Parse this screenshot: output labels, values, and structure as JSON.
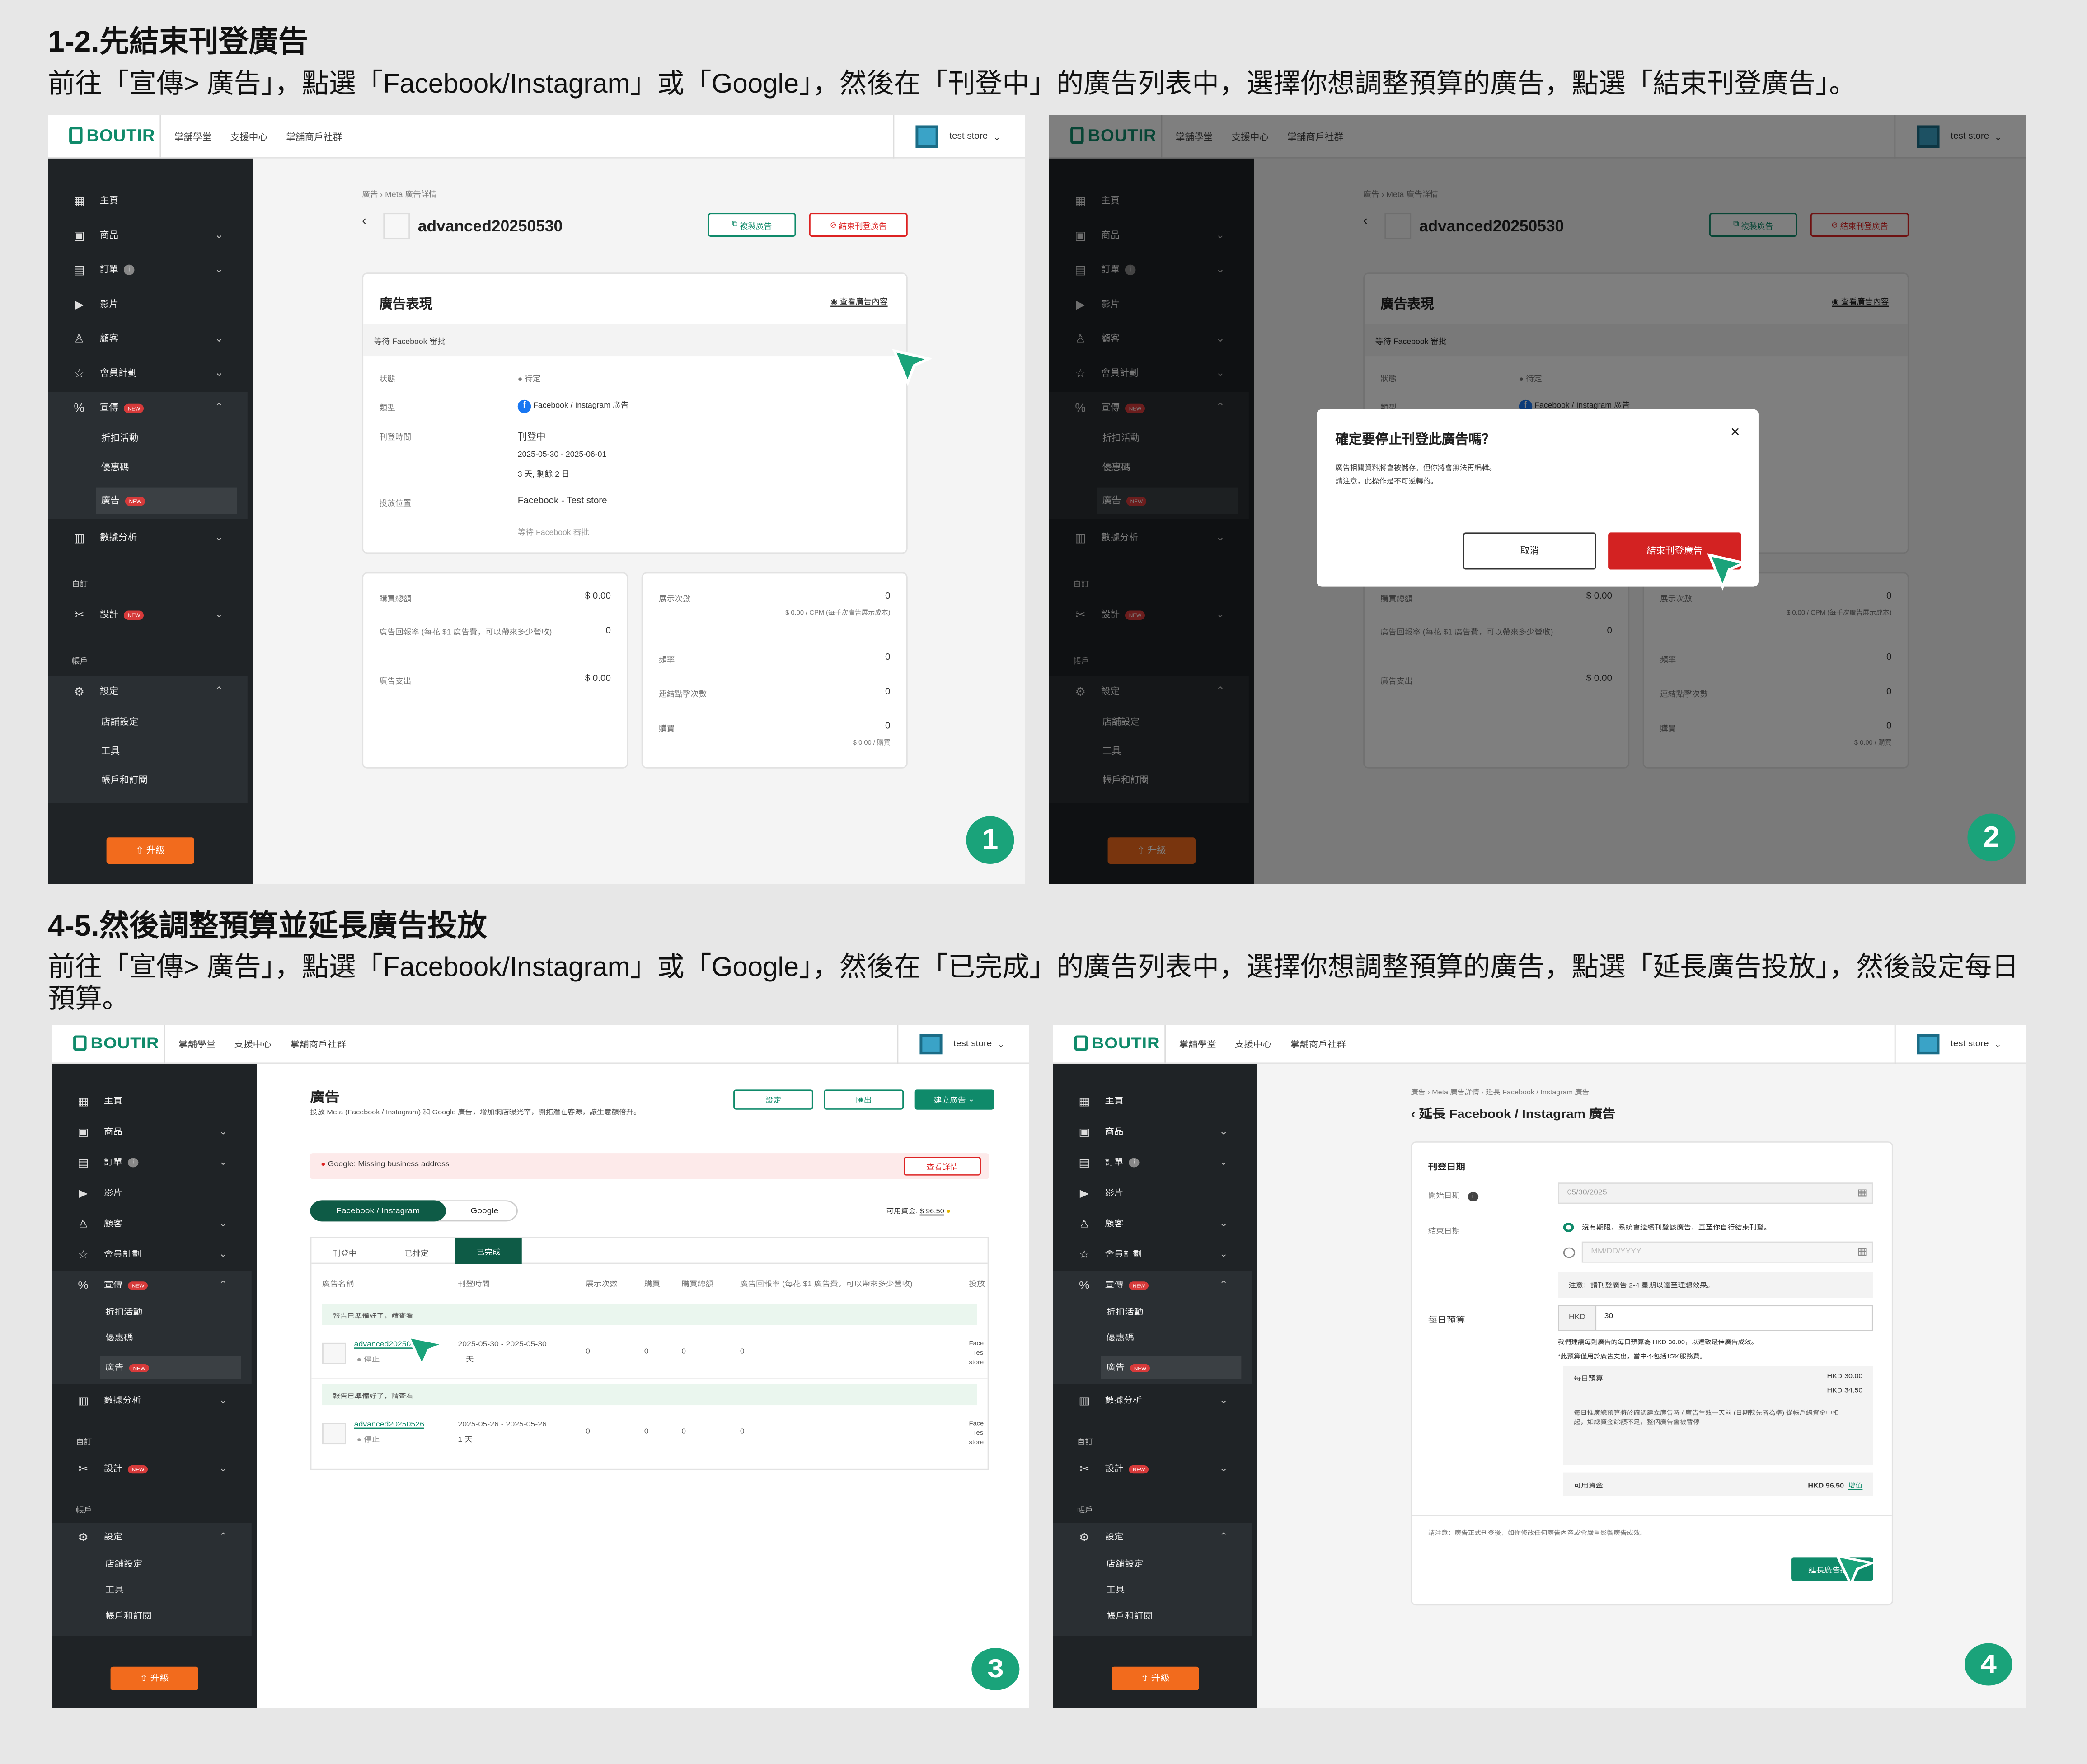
{
  "section1": {
    "heading": "1-2.先結束刊登廣告",
    "desc": "前往「宣傳> 廣告」，點選「Facebook/Instagram」或「Google」，然後在「刊登中」的廣告列表中，選擇你想調整預算的廣告，點選「結束刊登廣告」。"
  },
  "section2": {
    "heading": "4-5.然後調整預算並延長廣告投放",
    "desc": "前往「宣傳> 廣告」，點選「Facebook/Instagram」或「Google」，然後在「已完成」的廣告列表中，選擇你想調整預算的廣告，點選「延長廣告投放」，然後設定每日預算。"
  },
  "topbar": {
    "logo": "BOUTIR",
    "links": [
      "掌舖學堂",
      "支援中心",
      "掌舖商戶社群"
    ],
    "store": "test store"
  },
  "sidebar": {
    "home": "主頁",
    "products": "商品",
    "orders": "訂單",
    "videos": "影片",
    "customers": "顧客",
    "membership": "會員計劃",
    "promotion": "宣傳",
    "new_badge": "NEW",
    "discounts": "折扣活動",
    "coupons": "優惠碼",
    "ads": "廣告",
    "analytics": "數據分析",
    "custom_group": "自訂",
    "design": "設計",
    "account_group": "帳戶",
    "settings": "設定",
    "store_settings": "店舖設定",
    "tools": "工具",
    "billing": "帳戶和訂閱",
    "upgrade": "升級"
  },
  "step_numbers": [
    "1",
    "2",
    "3",
    "4"
  ],
  "detail": {
    "breadcrumb": "廣告 › Meta 廣告詳情",
    "ad_name": "advanced20250530",
    "copy_btn": "複製廣告",
    "stop_btn": "結束刊登廣告",
    "perf_title": "廣告表現",
    "view_content": "查看廣告內容",
    "waiting": "等待 Facebook 審批",
    "status_label": "狀態",
    "status_value": "待定",
    "type_label": "類型",
    "type_value": "Facebook / Instagram 廣告",
    "period_label": "刊登時間",
    "period_status": "刊登中",
    "period_range": "2025-05-30 - 2025-06-01",
    "period_left": "3 天, 剩餘 2 日",
    "placement_label": "投放位置",
    "placement_value": "Facebook - Test store",
    "placement_note": "等待 Facebook 審批",
    "purchase_total_label": "購買總額",
    "purchase_total": "$ 0.00",
    "roas_label": "廣告回報率 (每花 $1 廣告費，可以帶來多少營收)",
    "roas": "0",
    "spend_label": "廣告支出",
    "spend": "$ 0.00",
    "impressions_label": "展示次數",
    "impressions": "0",
    "cpm": "$ 0.00 / CPM (每千次廣告展示成本)",
    "freq_label": "頻率",
    "freq": "0",
    "clicks_label": "連結點擊次數",
    "clicks": "0",
    "purchases_label": "購買",
    "purchases": "0",
    "per_purchase": "$ 0.00 / 購買"
  },
  "modal": {
    "title": "確定要停止刊登此廣告嗎？",
    "line1": "廣告相關資料將會被儲存，但你將會無法再編輯。",
    "line2": "請注意，此操作是不可逆轉的。",
    "cancel": "取消",
    "confirm": "結束刊登廣告",
    "close": "×"
  },
  "ads_list": {
    "title": "廣告",
    "subtitle": "投放 Meta (Facebook / Instagram) 和 Google 廣告，增加網店曝光率，開拓潛在客源，讓生意額倍升。",
    "settings_btn": "設定",
    "export_btn": "匯出",
    "create_btn": "建立廣告",
    "alert": "Google: Missing business address",
    "alert_btn": "查看詳情",
    "toggle_fb": "Facebook / Instagram",
    "toggle_google": "Google",
    "funds_label": "可用資金:",
    "funds": "$ 96.50",
    "tabs": [
      "刊登中",
      "已排定",
      "已完成"
    ],
    "columns": [
      "廣告名稱",
      "刊登時間",
      "展示次數",
      "購買",
      "購買總額",
      "廣告回報率 (每花 $1 廣告費，可以帶來多少營收)",
      "投放"
    ],
    "ready_text": "報告已準備好了，請查看",
    "rows": [
      {
        "name": "advanced20250530",
        "status": "停止",
        "period": "2025-05-30 - 2025-05-30",
        "days": "天",
        "impressions": "0",
        "purchases": "0",
        "total": "0",
        "roas": "0",
        "placement": "Face - Tes store"
      },
      {
        "name": "advanced20250526",
        "status": "停止",
        "period": "2025-05-26 - 2025-05-26",
        "days": "1 天",
        "impressions": "0",
        "purchases": "0",
        "total": "0",
        "roas": "0",
        "placement": "Face - Tes store"
      }
    ]
  },
  "extend": {
    "breadcrumb": "廣告 › Meta 廣告詳情 › 延長 Facebook / Instagram 廣告",
    "title": "延長 Facebook / Instagram 廣告",
    "period_section": "刊登日期",
    "start_label": "開始日期",
    "start_value": "05/30/2025",
    "end_label": "結束日期",
    "no_end": "沒有期限，系統會繼續刊登該廣告，直至你自行結束刊登。",
    "date_placeholder": "MM/DD/YYYY",
    "note": "注意：請刊登廣告 2-4 星期以達至理想效果。",
    "budget_label": "每日預算",
    "currency": "HKD",
    "budget_value": "30",
    "suggest": "我們建議每則廣告的每日預算為 HKD 30.00，以達致最佳廣告成效。",
    "fee_note": "*此預算僅用於廣告支出，當中不包括15%服務費。",
    "daily_label": "每日預算",
    "daily_value": "HKD 30.00",
    "daily_fee_value": "HKD 34.50",
    "explain": "每日推廣總預算將於確認建立廣告時 / 廣告生效一天前 (日期較先者為準) 從帳戶總資金中扣起，如總資金餘額不足，整個廣告會被暫停",
    "funds_label": "可用資金",
    "funds_value": "HKD 96.50",
    "topup": "增值",
    "footer_note": "請注意：廣告正式刊登後，如你修改任何廣告內容或會嚴重影響廣告成效。",
    "submit": "延長廣告投放"
  },
  "colors": {
    "accent": "#0f8a6a",
    "danger": "#d22222",
    "sidebar": "#1f2326",
    "upgrade": "#f26b1d",
    "step": "#1aa37a"
  }
}
